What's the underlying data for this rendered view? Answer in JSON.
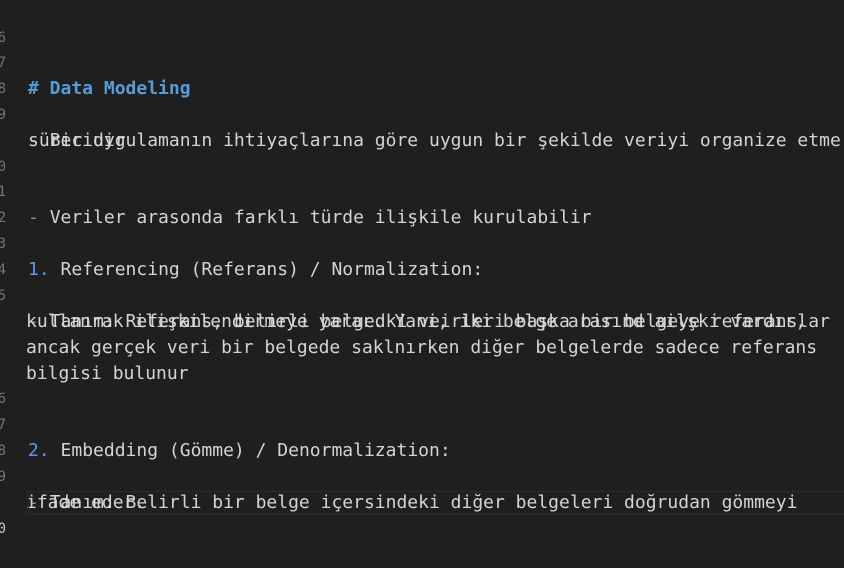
{
  "editor": {
    "gutter_numbers": [
      "6",
      "7",
      "8",
      "9",
      "",
      "0",
      "1",
      "2",
      "3",
      "4",
      "5",
      "",
      "",
      "",
      "6",
      "7",
      "8",
      "9",
      "",
      "0"
    ],
    "heading": "# Data Modeling",
    "bullet_marker": "-",
    "line_1a": "Bir uygulamanın ihtiyaçlarına göre uygun bir şekilde veriyi organize etme",
    "line_1b": "sürecidir",
    "line_2": "Veriler arasonda farklı türde ilişkile kurulabilir",
    "item_1_marker": "1.",
    "item_1_text": "Referencing (Referans) / Normalization:",
    "def_1a": "Tanım: Referans, belirli belgedki veirleri başka bir belgeye referanslar",
    "def_1b": "kullanrak ilişkilendirmeye yarar. Yani, iki belge arasınd ailşki vardır,",
    "def_1c": "ancak gerçek veri bir belgede saklnırken diğer belgelerde sadece referans",
    "def_1d": "bilgisi bulunur",
    "item_2_marker": "2.",
    "item_2_text": "Embedding (Gömme) / Denormalization:",
    "def_2a": "Tanım: Belirli bir belge içersindeki diğer belgeleri doğrudan gömmeyi",
    "def_2b": "ifade eder."
  }
}
